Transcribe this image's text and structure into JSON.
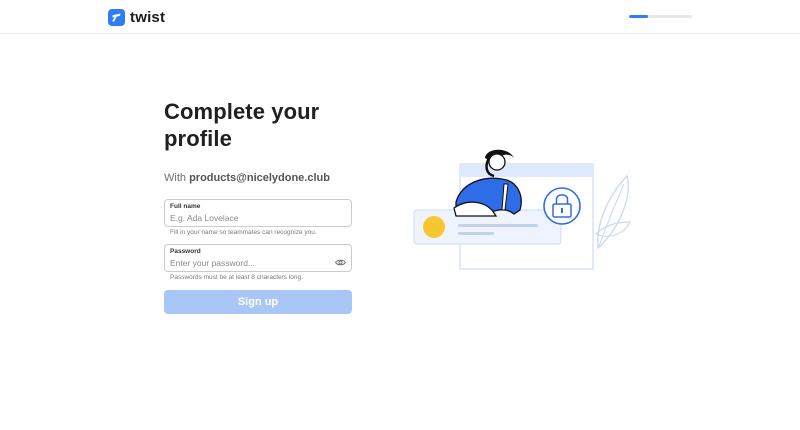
{
  "app": {
    "name": "twist",
    "brand_color": "#2f7df6",
    "logo_icon": "twist-logo-icon"
  },
  "progress": {
    "fraction": 0.3
  },
  "form": {
    "title": "Complete your profile",
    "subtitle_prefix": "With ",
    "email": "products@nicelydone.club",
    "full_name": {
      "label": "Full name",
      "placeholder": "E.g. Ada Lovelace",
      "value": "",
      "hint": "Fill in your name so teammates can recognize you."
    },
    "password": {
      "label": "Password",
      "placeholder": "Enter your password...",
      "value": "",
      "hint": "Passwords must be at least 8 characters long.",
      "toggle_icon": "eye-icon"
    },
    "submit_label": "Sign up",
    "submit_color": "#a9c7f6"
  },
  "illustration": {
    "icon": "profile-lock-illustration"
  }
}
